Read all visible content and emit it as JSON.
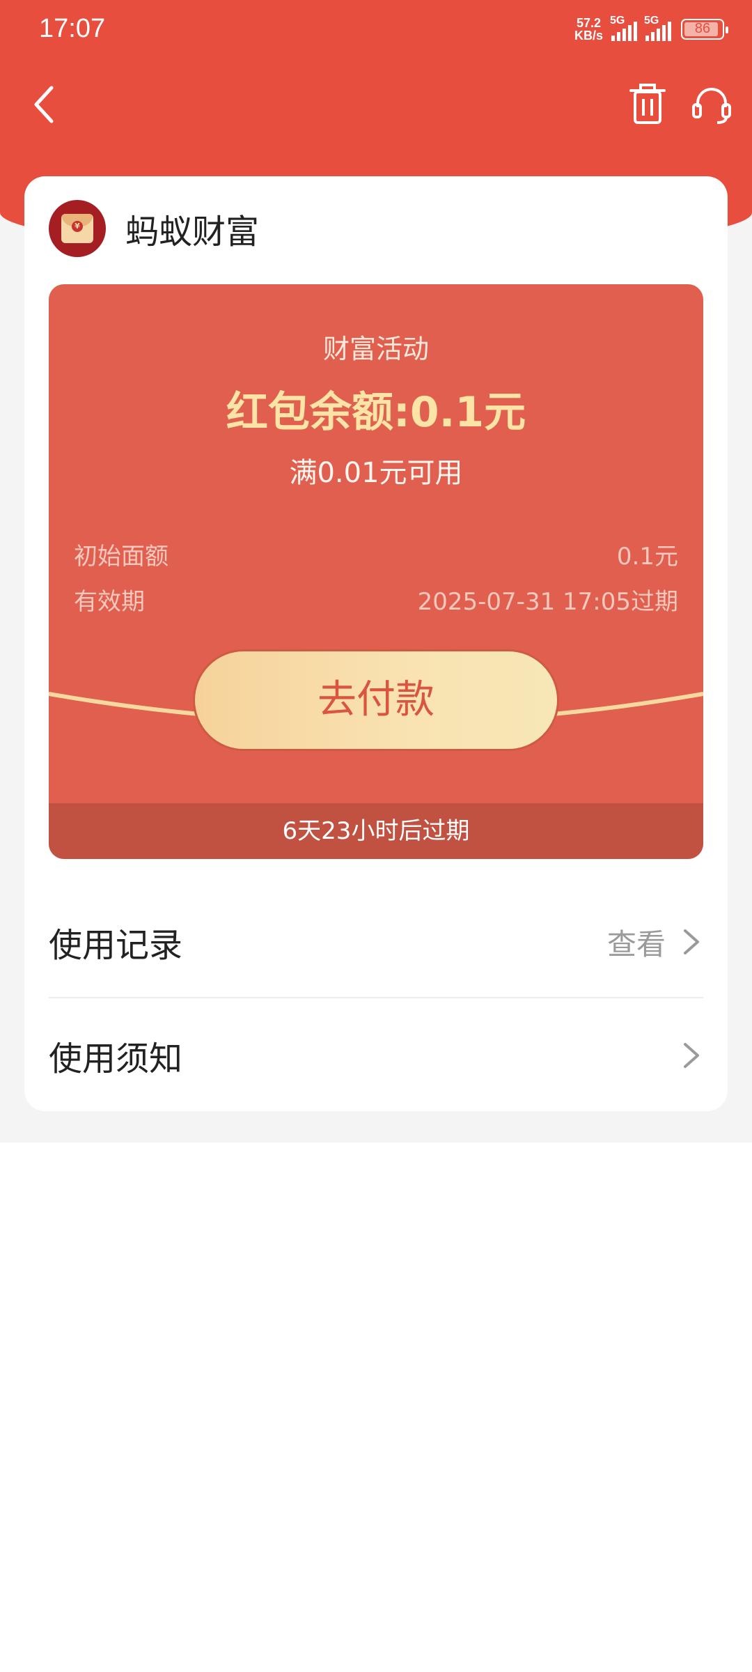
{
  "status_bar": {
    "time": "17:07",
    "net_speed_value": "57.2",
    "net_speed_unit": "KB/s",
    "sim1": "5G",
    "sim2": "5G",
    "battery": "86"
  },
  "nav": {
    "back_icon": "chevron-left-icon",
    "delete_icon": "trash-icon",
    "service_icon": "headset-icon"
  },
  "merchant": {
    "name": "蚂蚁财富",
    "logo_icon": "red-envelope-icon"
  },
  "coupon": {
    "activity": "财富活动",
    "balance": "红包余额:0.1元",
    "threshold": "满0.01元可用",
    "rows": [
      {
        "label": "初始面额",
        "value": "0.1元"
      },
      {
        "label": "有效期",
        "value": "2025-07-31 17:05过期"
      }
    ],
    "pay_button": "去付款",
    "expire_notice": "6天23小时后过期"
  },
  "list": [
    {
      "title": "使用记录",
      "action": "查看"
    },
    {
      "title": "使用须知",
      "action": ""
    }
  ],
  "colors": {
    "header_red": "#e84e3e",
    "coupon_red": "#e05f4f",
    "gold": "#fbe4a6"
  }
}
